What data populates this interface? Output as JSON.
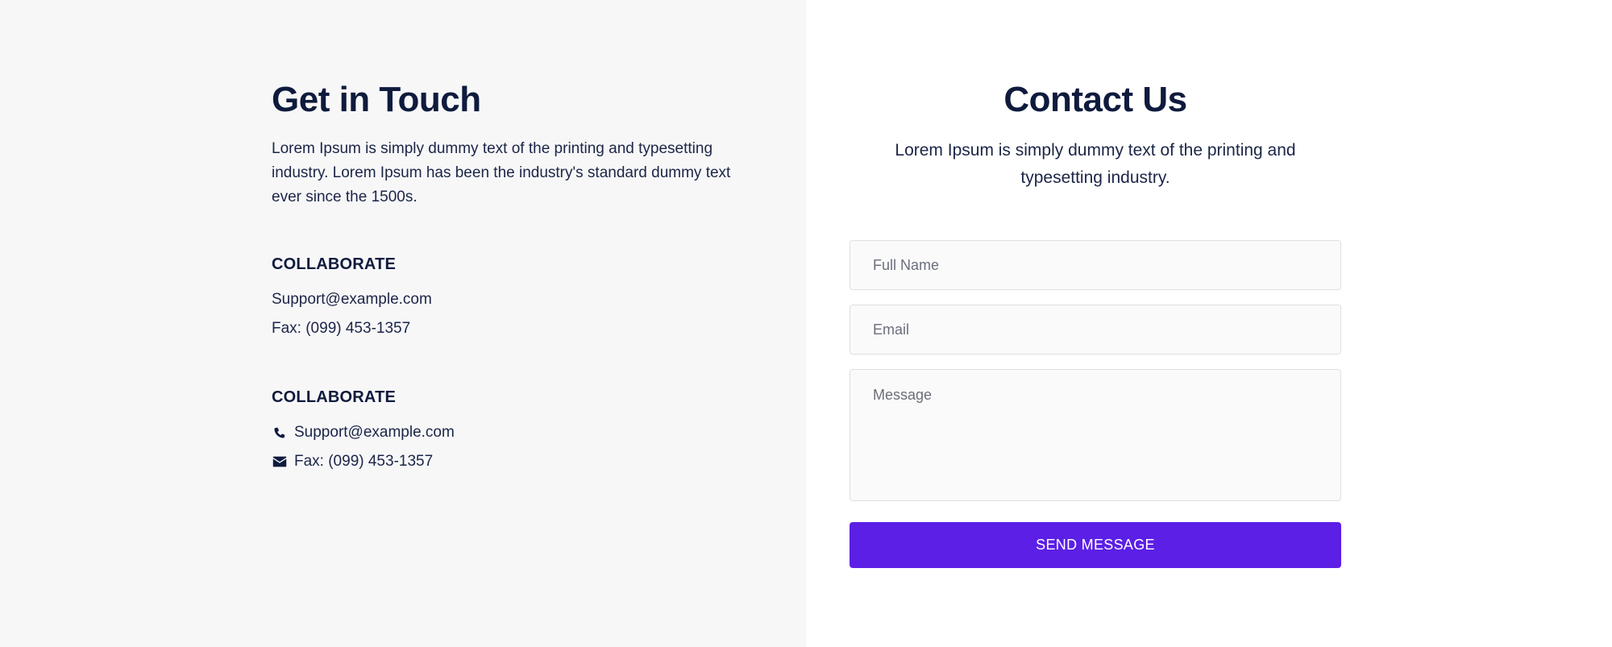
{
  "get_in_touch": {
    "title": "Get in Touch",
    "description": "Lorem Ipsum is simply dummy text of the printing and typesetting industry. Lorem Ipsum has been the industry's standard dummy text ever since the 1500s.",
    "sections": [
      {
        "heading": "COLLABORATE",
        "lines": [
          "Support@example.com",
          "Fax: (099) 453-1357"
        ]
      },
      {
        "heading": "COLLABORATE",
        "lines": [
          {
            "icon": "phone-icon",
            "text": "Support@example.com"
          },
          {
            "icon": "envelope-icon",
            "text": "Fax: (099) 453-1357"
          }
        ]
      }
    ]
  },
  "contact_us": {
    "title": "Contact Us",
    "description": "Lorem Ipsum is simply dummy text of the printing and typesetting industry.",
    "form": {
      "full_name": {
        "placeholder": "Full Name",
        "value": ""
      },
      "email": {
        "placeholder": "Email",
        "value": ""
      },
      "message": {
        "placeholder": "Message",
        "value": ""
      },
      "submit_label": "SEND MESSAGE"
    }
  },
  "colors": {
    "left_background": "#f7f7f8",
    "right_background": "#ffffff",
    "heading_text": "#0f1b3d",
    "button_background": "#5b1fe6",
    "button_text": "#ffffff",
    "field_border": "#dedfe2",
    "field_background": "#fafafa"
  }
}
